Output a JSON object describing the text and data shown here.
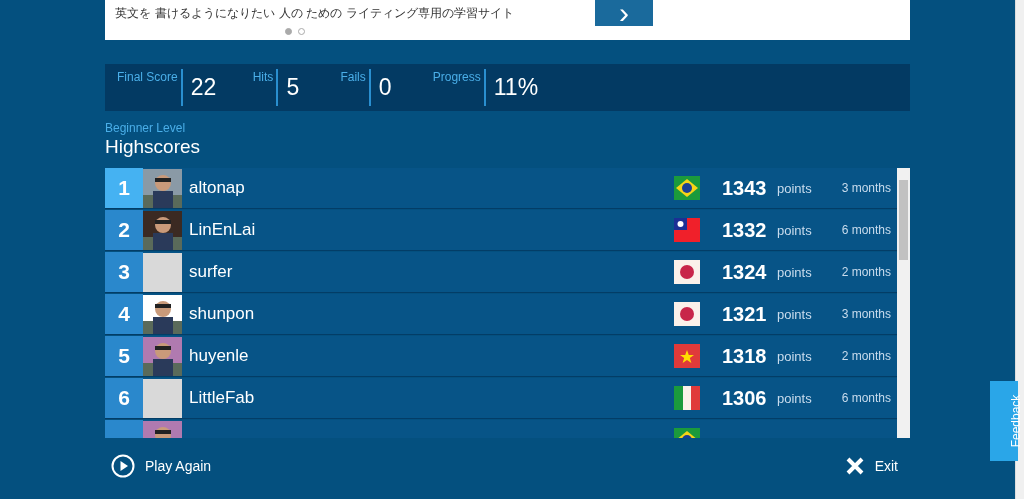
{
  "ad": {
    "text": "英文を 書けるようになりたい 人の ための ライティング専用の学習サイト",
    "next_label": "›",
    "dots": [
      {
        "selected": true
      },
      {
        "selected": false
      }
    ]
  },
  "stats": [
    {
      "label": "Final Score",
      "value": "22"
    },
    {
      "label": "Hits",
      "value": "5"
    },
    {
      "label": "Fails",
      "value": "0"
    },
    {
      "label": "Progress",
      "value": "11%"
    }
  ],
  "level": "Beginner Level",
  "title": "Highscores",
  "rows": [
    {
      "rank": "1",
      "name": "altonap",
      "flag": {
        "kind": "brazil"
      },
      "score": "1343",
      "unit": "points",
      "age": "3 months",
      "selected": true
    },
    {
      "rank": "2",
      "name": "LinEnLai",
      "flag": {
        "kind": "taiwan"
      },
      "score": "1332",
      "unit": "points",
      "age": "6 months",
      "selected": false
    },
    {
      "rank": "3",
      "avatar": {
        "kind": "blank"
      },
      "name": "surfer",
      "flag": {
        "kind": "japan"
      },
      "score": "1324",
      "unit": "points",
      "age": "2 months",
      "selected": false
    },
    {
      "rank": "4",
      "name": "shunpon",
      "flag": {
        "kind": "japan"
      },
      "score": "1321",
      "unit": "points",
      "age": "3 months",
      "selected": false
    },
    {
      "rank": "5",
      "name": "huyenle",
      "flag": {
        "kind": "vietnam"
      },
      "score": "1318",
      "unit": "points",
      "age": "2 months",
      "selected": false
    },
    {
      "rank": "6",
      "avatar": {
        "kind": "blank"
      },
      "name": "LittleFab",
      "flag": {
        "kind": "italy"
      },
      "score": "1306",
      "unit": "points",
      "age": "6 months",
      "selected": false
    },
    {
      "flag": {
        "kind": "brazil"
      },
      "selected": false
    }
  ],
  "actions": {
    "play_again": "Play Again",
    "exit": "Exit"
  },
  "feedback": "Feedback"
}
